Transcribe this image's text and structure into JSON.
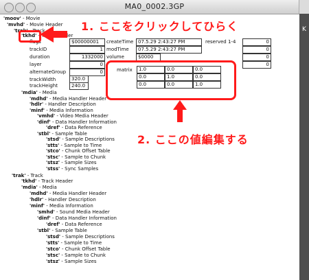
{
  "window": {
    "title": "MA0_0002.3GP"
  },
  "annotations": {
    "step1": "1. ここをクリックしてひらく",
    "step2": "2. ここの値編集する"
  },
  "tree1": [
    {
      "atom": "'moov'",
      "desc": "Movie"
    },
    {
      "atom": "'mvhd'",
      "desc": "Movie Header"
    },
    {
      "atom": "'trak'",
      "desc": "Track"
    },
    {
      "atom": "'tkhd'",
      "desc": "Track Header"
    }
  ],
  "tkhd": {
    "fields": [
      {
        "label": "flags",
        "value": "$00000001"
      },
      {
        "label": "trackID",
        "value": "1"
      },
      {
        "label": "duration",
        "value": "1332000"
      },
      {
        "label": "layer",
        "value": "0"
      },
      {
        "label": "alternateGroup",
        "value": "0"
      },
      {
        "label": "trackWidth",
        "value": "320.0"
      },
      {
        "label": "trackHeight",
        "value": "240.0"
      }
    ],
    "times": [
      {
        "label": "createTime",
        "value": "07.5.29 2:43:27 PM"
      },
      {
        "label": "modTime",
        "value": "07.5.29 2:43:27 PM"
      },
      {
        "label": "volume",
        "value": "$0000"
      }
    ],
    "reserved_label": "reserved 1-4",
    "reserved": [
      "0",
      "0",
      "0",
      "0"
    ],
    "matrix_label": "matrix",
    "matrix": [
      [
        "1.0",
        "0.0",
        "0.0"
      ],
      [
        "0.0",
        "1.0",
        "0.0"
      ],
      [
        "0.0",
        "0.0",
        "1.0"
      ]
    ]
  },
  "tree2": [
    {
      "atom": "'mdia'",
      "desc": "Media"
    },
    {
      "atom": "'mdhd'",
      "desc": "Media Handler Header"
    },
    {
      "atom": "'hdlr'",
      "desc": "Handler Description"
    },
    {
      "atom": "'minf'",
      "desc": "Media Information"
    },
    {
      "atom": "'vmhd'",
      "desc": "Video Media Header"
    },
    {
      "atom": "'dinf'",
      "desc": "Data Handler Information"
    },
    {
      "atom": "'dref'",
      "desc": "Data Reference"
    },
    {
      "atom": "'stbl'",
      "desc": "Sample Table"
    },
    {
      "atom": "'stsd'",
      "desc": "Sample Descriptions"
    },
    {
      "atom": "'stts'",
      "desc": "Sample to Time"
    },
    {
      "atom": "'stco'",
      "desc": "Chunk Offset Table"
    },
    {
      "atom": "'stsc'",
      "desc": "Sample to Chunk"
    },
    {
      "atom": "'stsz'",
      "desc": "Sample Sizes"
    },
    {
      "atom": "'stss'",
      "desc": "Sync Samples"
    },
    {
      "atom": "'trak'",
      "desc": "Track"
    },
    {
      "atom": "'tkhd'",
      "desc": "Track Header"
    },
    {
      "atom": "'mdia'",
      "desc": "Media"
    },
    {
      "atom": "'mdhd'",
      "desc": "Media Handler Header"
    },
    {
      "atom": "'hdlr'",
      "desc": "Handler Description"
    },
    {
      "atom": "'minf'",
      "desc": "Media Information"
    },
    {
      "atom": "'smhd'",
      "desc": "Sound Media Header"
    },
    {
      "atom": "'dinf'",
      "desc": "Data Handler Information"
    },
    {
      "atom": "'dref'",
      "desc": "Data Reference"
    },
    {
      "atom": "'stbl'",
      "desc": "Sample Table"
    },
    {
      "atom": "'stsd'",
      "desc": "Sample Descriptions"
    },
    {
      "atom": "'stts'",
      "desc": "Sample to Time"
    },
    {
      "atom": "'stco'",
      "desc": "Chunk Offset Table"
    },
    {
      "atom": "'stsc'",
      "desc": "Sample to Chunk"
    },
    {
      "atom": "'stsz'",
      "desc": "Sample Sizes"
    }
  ]
}
